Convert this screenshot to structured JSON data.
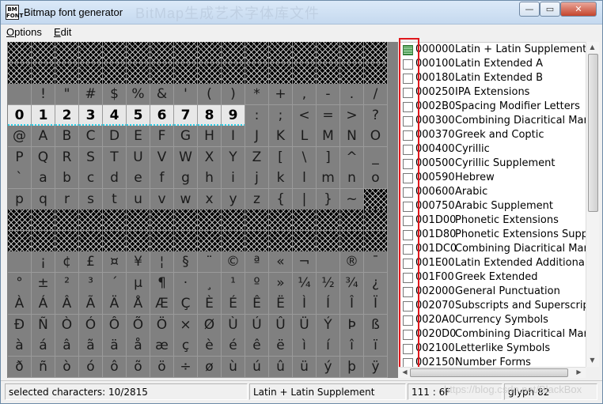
{
  "window": {
    "title": "Bitmap font generator",
    "icon_text": "BM FONT",
    "ghost_title": "BitMap生成艺术字体库文件"
  },
  "titlebar_buttons": {
    "minimize": "—",
    "maximize": "▭",
    "close": "✕"
  },
  "menu": [
    {
      "label": "Options",
      "accel": "O",
      "rest": "ptions"
    },
    {
      "label": "Edit",
      "accel": "E",
      "rest": "dit"
    }
  ],
  "grid": {
    "columns": 16,
    "rows": [
      {
        "state": "empty",
        "chars": []
      },
      {
        "state": "empty",
        "chars": []
      },
      {
        "state": "chars",
        "chars": [
          " ",
          "!",
          "\"",
          "#",
          "$",
          "%",
          "&",
          "'",
          "(",
          ")",
          "*",
          "+",
          ",",
          "-",
          ".",
          "/"
        ]
      },
      {
        "state": "chars",
        "chars": [
          "0",
          "1",
          "2",
          "3",
          "4",
          "5",
          "6",
          "7",
          "8",
          "9",
          ":",
          ";",
          "<",
          "=",
          ">",
          "?"
        ],
        "selected": [
          0,
          1,
          2,
          3,
          4,
          5,
          6,
          7,
          8,
          9
        ]
      },
      {
        "state": "chars",
        "chars": [
          "@",
          "A",
          "B",
          "C",
          "D",
          "E",
          "F",
          "G",
          "H",
          "I",
          "J",
          "K",
          "L",
          "M",
          "N",
          "O"
        ]
      },
      {
        "state": "chars",
        "chars": [
          "P",
          "Q",
          "R",
          "S",
          "T",
          "U",
          "V",
          "W",
          "X",
          "Y",
          "Z",
          "[",
          "\\",
          "]",
          "^",
          "_"
        ]
      },
      {
        "state": "chars",
        "chars": [
          "`",
          "a",
          "b",
          "c",
          "d",
          "e",
          "f",
          "g",
          "h",
          "i",
          "j",
          "k",
          "l",
          "m",
          "n",
          "o"
        ]
      },
      {
        "state": "chars",
        "chars": [
          "p",
          "q",
          "r",
          "s",
          "t",
          "u",
          "v",
          "w",
          "x",
          "y",
          "z",
          "{",
          "|",
          "}",
          "~",
          ""
        ],
        "empty": [
          15
        ]
      },
      {
        "state": "empty",
        "chars": []
      },
      {
        "state": "empty",
        "chars": []
      },
      {
        "state": "chars",
        "chars": [
          " ",
          "¡",
          "¢",
          "£",
          "¤",
          "¥",
          "¦",
          "§",
          "¨",
          "©",
          "ª",
          "«",
          "¬",
          "­",
          "®",
          "¯"
        ]
      },
      {
        "state": "chars",
        "chars": [
          "°",
          "±",
          "²",
          "³",
          "´",
          "µ",
          "¶",
          "·",
          "¸",
          "¹",
          "º",
          "»",
          "¼",
          "½",
          "¾",
          "¿"
        ]
      },
      {
        "state": "chars",
        "chars": [
          "À",
          "Á",
          "Â",
          "Ã",
          "Ä",
          "Å",
          "Æ",
          "Ç",
          "È",
          "É",
          "Ê",
          "Ë",
          "Ì",
          "Í",
          "Î",
          "Ï"
        ]
      },
      {
        "state": "chars",
        "chars": [
          "Ð",
          "Ñ",
          "Ò",
          "Ó",
          "Ô",
          "Õ",
          "Ö",
          "×",
          "Ø",
          "Ù",
          "Ú",
          "Û",
          "Ü",
          "Ý",
          "Þ",
          "ß"
        ]
      },
      {
        "state": "chars",
        "chars": [
          "à",
          "á",
          "â",
          "ã",
          "ä",
          "å",
          "æ",
          "ç",
          "è",
          "é",
          "ê",
          "ë",
          "ì",
          "í",
          "î",
          "ï"
        ]
      },
      {
        "state": "chars",
        "chars": [
          "ð",
          "ñ",
          "ò",
          "ó",
          "ô",
          "õ",
          "ö",
          "÷",
          "ø",
          "ù",
          "ú",
          "û",
          "ü",
          "ý",
          "þ",
          "ÿ"
        ]
      }
    ]
  },
  "unicode_ranges": [
    {
      "code": "000000",
      "name": "Latin + Latin Supplement",
      "checked": true
    },
    {
      "code": "000100",
      "name": "Latin Extended A",
      "checked": false
    },
    {
      "code": "000180",
      "name": "Latin Extended B",
      "checked": false
    },
    {
      "code": "000250",
      "name": "IPA Extensions",
      "checked": false
    },
    {
      "code": "0002B0",
      "name": "Spacing Modifier Letters",
      "checked": false
    },
    {
      "code": "000300",
      "name": "Combining Diacritical Marks",
      "checked": false
    },
    {
      "code": "000370",
      "name": "Greek and Coptic",
      "checked": false
    },
    {
      "code": "000400",
      "name": "Cyrillic",
      "checked": false
    },
    {
      "code": "000500",
      "name": "Cyrillic Supplement",
      "checked": false
    },
    {
      "code": "000590",
      "name": "Hebrew",
      "checked": false
    },
    {
      "code": "000600",
      "name": "Arabic",
      "checked": false
    },
    {
      "code": "000750",
      "name": "Arabic Supplement",
      "checked": false
    },
    {
      "code": "001D00",
      "name": "Phonetic Extensions",
      "checked": false
    },
    {
      "code": "001D80",
      "name": "Phonetic Extensions Supple.",
      "checked": false
    },
    {
      "code": "001DC0",
      "name": "Combining Diacritical Marks",
      "checked": false
    },
    {
      "code": "001E00",
      "name": "Latin Extended Additional",
      "checked": false
    },
    {
      "code": "001F00",
      "name": "Greek Extended",
      "checked": false
    },
    {
      "code": "002000",
      "name": "General Punctuation",
      "checked": false
    },
    {
      "code": "002070",
      "name": "Subscripts and Superscripts",
      "checked": false
    },
    {
      "code": "0020A0",
      "name": "Currency Symbols",
      "checked": false
    },
    {
      "code": "0020D0",
      "name": "Combining Diacritical Marks",
      "checked": false
    },
    {
      "code": "002100",
      "name": "Letterlike Symbols",
      "checked": false
    },
    {
      "code": "002150",
      "name": "Number Forms",
      "checked": false
    }
  ],
  "status": {
    "selected": "selected characters: 10/2815",
    "range": "Latin + Latin Supplement",
    "code": "111 : 6F",
    "glyph": "glyph 82"
  },
  "watermark": "https://blog.csdn.net/BlackBox"
}
